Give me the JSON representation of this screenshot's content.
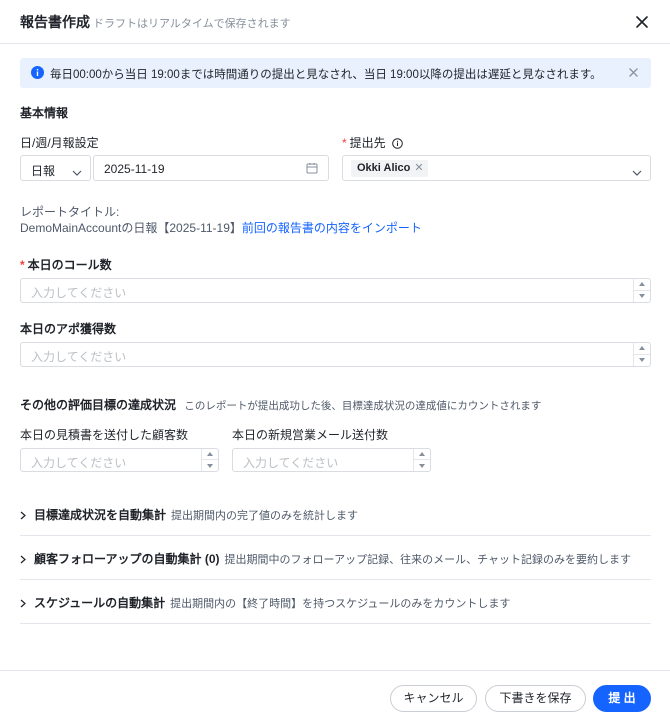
{
  "header": {
    "title": "報告書作成",
    "subtitle": "ドラフトはリアルタイムで保存されます"
  },
  "notice": {
    "text": "毎日00:00から当日 19:00までは時間通りの提出と見なされ、当日 19:00以降の提出は遅延と見なされます。"
  },
  "basic": {
    "section_title": "基本情報",
    "period_label": "日/週/月報設定",
    "period_value": "日報",
    "date_value": "2025-11-19",
    "recipient_label": "提出先",
    "recipient_tag": "Okki Alico"
  },
  "report": {
    "title_label": "レポートタイトル:",
    "title_value": "DemoMainAccountの日報【2025-11-19】",
    "import_link": "前回の報告書の内容をインポート"
  },
  "fields": {
    "calls_label": "本日のコール数",
    "calls_placeholder": "入力してください",
    "appointments_label": "本日のアポ獲得数",
    "appointments_placeholder": "入力してください"
  },
  "other": {
    "title": "その他の評価目標の達成状況",
    "desc": "このレポートが提出成功した後、目標達成状況の達成値にカウントされます",
    "quotes_label": "本日の見積書を送付した顧客数",
    "quotes_placeholder": "入力してください",
    "emails_label": "本日の新規営業メール送付数",
    "emails_placeholder": "入力してください"
  },
  "collapses": [
    {
      "title": "目標達成状況を自動集計",
      "desc": "提出期間内の完了値のみを統計します"
    },
    {
      "title": "顧客フォローアップの自動集計 (0)",
      "desc": "提出期間中のフォローアップ記録、往来のメール、チャット記録のみを要約します"
    },
    {
      "title": "スケジュールの自動集計",
      "desc": "提出期間内の【終了時間】を持つスケジュールのみをカウントします"
    }
  ],
  "footer": {
    "cancel": "キャンセル",
    "save_draft": "下書きを保存",
    "submit": "提 出"
  },
  "colors": {
    "primary": "#1664ff",
    "required": "#f53f3f",
    "notice_bg": "#e8f1fd"
  }
}
